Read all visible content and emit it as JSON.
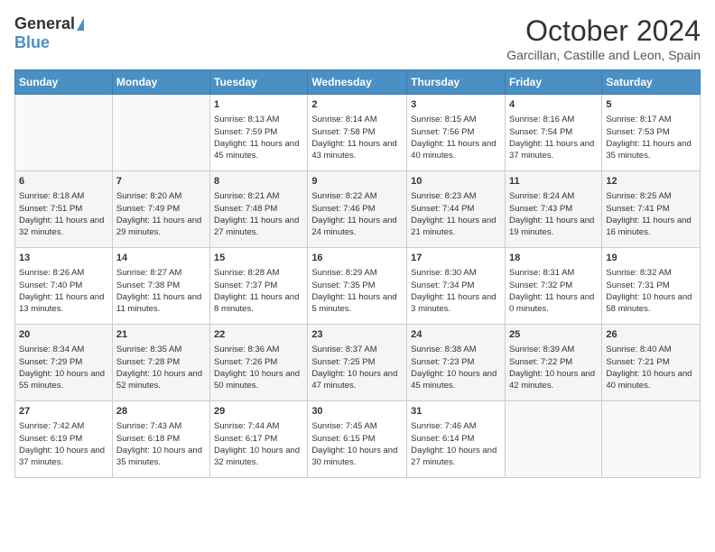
{
  "header": {
    "logo_general": "General",
    "logo_blue": "Blue",
    "month_title": "October 2024",
    "location": "Garcillan, Castille and Leon, Spain"
  },
  "days_of_week": [
    "Sunday",
    "Monday",
    "Tuesday",
    "Wednesday",
    "Thursday",
    "Friday",
    "Saturday"
  ],
  "weeks": [
    [
      {
        "day": "",
        "info": ""
      },
      {
        "day": "",
        "info": ""
      },
      {
        "day": "1",
        "info": "Sunrise: 8:13 AM\nSunset: 7:59 PM\nDaylight: 11 hours and 45 minutes."
      },
      {
        "day": "2",
        "info": "Sunrise: 8:14 AM\nSunset: 7:58 PM\nDaylight: 11 hours and 43 minutes."
      },
      {
        "day": "3",
        "info": "Sunrise: 8:15 AM\nSunset: 7:56 PM\nDaylight: 11 hours and 40 minutes."
      },
      {
        "day": "4",
        "info": "Sunrise: 8:16 AM\nSunset: 7:54 PM\nDaylight: 11 hours and 37 minutes."
      },
      {
        "day": "5",
        "info": "Sunrise: 8:17 AM\nSunset: 7:53 PM\nDaylight: 11 hours and 35 minutes."
      }
    ],
    [
      {
        "day": "6",
        "info": "Sunrise: 8:18 AM\nSunset: 7:51 PM\nDaylight: 11 hours and 32 minutes."
      },
      {
        "day": "7",
        "info": "Sunrise: 8:20 AM\nSunset: 7:49 PM\nDaylight: 11 hours and 29 minutes."
      },
      {
        "day": "8",
        "info": "Sunrise: 8:21 AM\nSunset: 7:48 PM\nDaylight: 11 hours and 27 minutes."
      },
      {
        "day": "9",
        "info": "Sunrise: 8:22 AM\nSunset: 7:46 PM\nDaylight: 11 hours and 24 minutes."
      },
      {
        "day": "10",
        "info": "Sunrise: 8:23 AM\nSunset: 7:44 PM\nDaylight: 11 hours and 21 minutes."
      },
      {
        "day": "11",
        "info": "Sunrise: 8:24 AM\nSunset: 7:43 PM\nDaylight: 11 hours and 19 minutes."
      },
      {
        "day": "12",
        "info": "Sunrise: 8:25 AM\nSunset: 7:41 PM\nDaylight: 11 hours and 16 minutes."
      }
    ],
    [
      {
        "day": "13",
        "info": "Sunrise: 8:26 AM\nSunset: 7:40 PM\nDaylight: 11 hours and 13 minutes."
      },
      {
        "day": "14",
        "info": "Sunrise: 8:27 AM\nSunset: 7:38 PM\nDaylight: 11 hours and 11 minutes."
      },
      {
        "day": "15",
        "info": "Sunrise: 8:28 AM\nSunset: 7:37 PM\nDaylight: 11 hours and 8 minutes."
      },
      {
        "day": "16",
        "info": "Sunrise: 8:29 AM\nSunset: 7:35 PM\nDaylight: 11 hours and 5 minutes."
      },
      {
        "day": "17",
        "info": "Sunrise: 8:30 AM\nSunset: 7:34 PM\nDaylight: 11 hours and 3 minutes."
      },
      {
        "day": "18",
        "info": "Sunrise: 8:31 AM\nSunset: 7:32 PM\nDaylight: 11 hours and 0 minutes."
      },
      {
        "day": "19",
        "info": "Sunrise: 8:32 AM\nSunset: 7:31 PM\nDaylight: 10 hours and 58 minutes."
      }
    ],
    [
      {
        "day": "20",
        "info": "Sunrise: 8:34 AM\nSunset: 7:29 PM\nDaylight: 10 hours and 55 minutes."
      },
      {
        "day": "21",
        "info": "Sunrise: 8:35 AM\nSunset: 7:28 PM\nDaylight: 10 hours and 52 minutes."
      },
      {
        "day": "22",
        "info": "Sunrise: 8:36 AM\nSunset: 7:26 PM\nDaylight: 10 hours and 50 minutes."
      },
      {
        "day": "23",
        "info": "Sunrise: 8:37 AM\nSunset: 7:25 PM\nDaylight: 10 hours and 47 minutes."
      },
      {
        "day": "24",
        "info": "Sunrise: 8:38 AM\nSunset: 7:23 PM\nDaylight: 10 hours and 45 minutes."
      },
      {
        "day": "25",
        "info": "Sunrise: 8:39 AM\nSunset: 7:22 PM\nDaylight: 10 hours and 42 minutes."
      },
      {
        "day": "26",
        "info": "Sunrise: 8:40 AM\nSunset: 7:21 PM\nDaylight: 10 hours and 40 minutes."
      }
    ],
    [
      {
        "day": "27",
        "info": "Sunrise: 7:42 AM\nSunset: 6:19 PM\nDaylight: 10 hours and 37 minutes."
      },
      {
        "day": "28",
        "info": "Sunrise: 7:43 AM\nSunset: 6:18 PM\nDaylight: 10 hours and 35 minutes."
      },
      {
        "day": "29",
        "info": "Sunrise: 7:44 AM\nSunset: 6:17 PM\nDaylight: 10 hours and 32 minutes."
      },
      {
        "day": "30",
        "info": "Sunrise: 7:45 AM\nSunset: 6:15 PM\nDaylight: 10 hours and 30 minutes."
      },
      {
        "day": "31",
        "info": "Sunrise: 7:46 AM\nSunset: 6:14 PM\nDaylight: 10 hours and 27 minutes."
      },
      {
        "day": "",
        "info": ""
      },
      {
        "day": "",
        "info": ""
      }
    ]
  ]
}
